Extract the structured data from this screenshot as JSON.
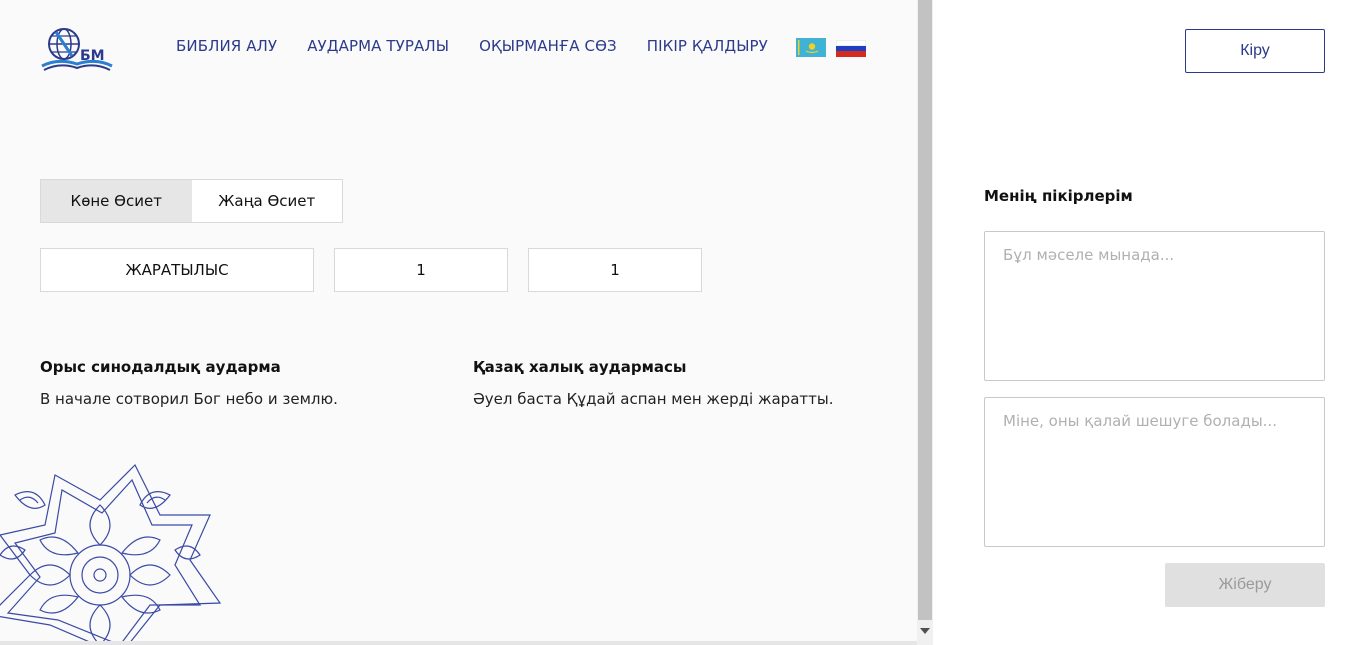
{
  "header": {
    "logo_text": "БМ",
    "nav": [
      {
        "label": "БИБЛИЯ АЛУ"
      },
      {
        "label": "АУДАРМА ТУРАЛЫ"
      },
      {
        "label": "ОҚЫРМАНҒА СӨЗ"
      },
      {
        "label": "ПІКІР ҚАЛДЫРУ"
      }
    ],
    "flags": [
      "kazakhstan-flag",
      "russia-flag"
    ]
  },
  "testament_tabs": [
    {
      "label": "Көне Өсиет",
      "active": true
    },
    {
      "label": "Жаңа Өсиет",
      "active": false
    }
  ],
  "selectors": {
    "book": "ЖАРАТЫЛЫС",
    "chapter": "1",
    "verse": "1"
  },
  "translations": {
    "russian": {
      "title": "Орыс синодалдық аударма",
      "text": "В начале сотворил Бог небо и землю."
    },
    "kazakh": {
      "title": "Қазақ халық аудармасы",
      "text": "Әуел баста Құдай аспан мен жерді жаратты."
    }
  },
  "sidebar": {
    "login_label": "Кіру",
    "feedback_title": "Менің пікірлерім",
    "problem_placeholder": "Бұл мәселе мынада...",
    "solution_placeholder": "Міне, оны қалай шешуге болады...",
    "send_label": "Жіберу"
  },
  "colors": {
    "accent": "#2c3a8c",
    "background": "#fafafa",
    "disabled_button": "#e0e0e0"
  }
}
